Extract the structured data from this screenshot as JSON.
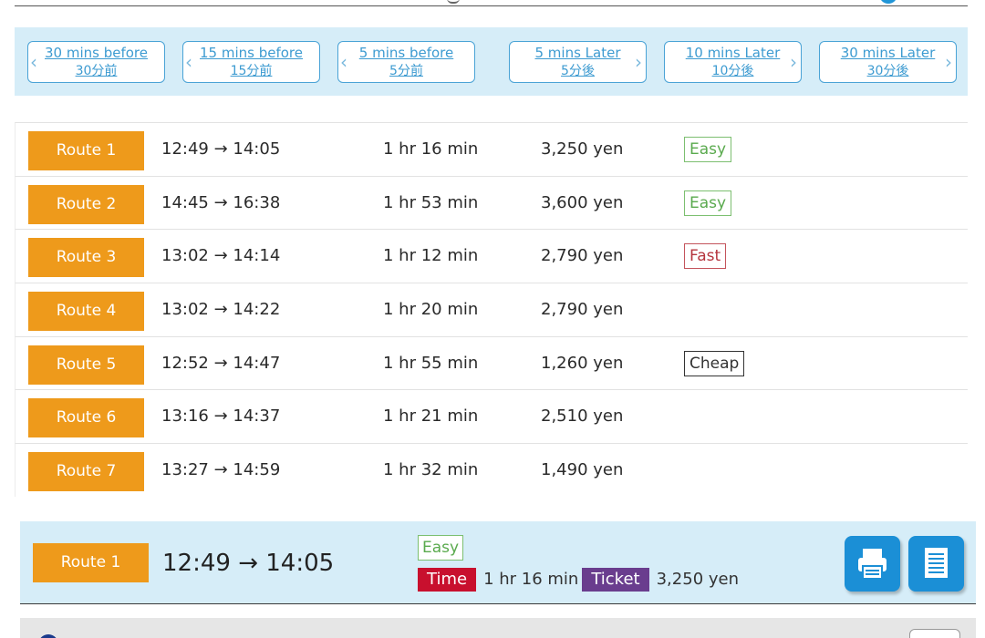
{
  "time_nav": [
    {
      "line1": "30 mins before",
      "line2": "30分前",
      "direction": "left"
    },
    {
      "line1": "15 mins before",
      "line2": "15分前",
      "direction": "left"
    },
    {
      "line1": "5 mins before",
      "line2": "5分前",
      "direction": "left"
    },
    {
      "line1": "5 mins Later",
      "line2": "5分後",
      "direction": "right"
    },
    {
      "line1": "10 mins Later",
      "line2": "10分後",
      "direction": "right"
    },
    {
      "line1": "30 mins Later",
      "line2": "30分後",
      "direction": "right"
    }
  ],
  "routes": [
    {
      "label": "Route 1",
      "time": "12:49 → 14:05",
      "duration": "1 hr 16 min",
      "fare": "3,250 yen",
      "tag": "Easy"
    },
    {
      "label": "Route 2",
      "time": "14:45 → 16:38",
      "duration": "1 hr 53 min",
      "fare": "3,600 yen",
      "tag": "Easy"
    },
    {
      "label": "Route 3",
      "time": "13:02 → 14:14",
      "duration": "1 hr 12 min",
      "fare": "2,790 yen",
      "tag": "Fast"
    },
    {
      "label": "Route 4",
      "time": "13:02 → 14:22",
      "duration": "1 hr 20 min",
      "fare": "2,790 yen",
      "tag": ""
    },
    {
      "label": "Route 5",
      "time": "12:52 → 14:47",
      "duration": "1 hr 55 min",
      "fare": "1,260 yen",
      "tag": "Cheap"
    },
    {
      "label": "Route 6",
      "time": "13:16 → 14:37",
      "duration": "1 hr 21 min",
      "fare": "2,510 yen",
      "tag": ""
    },
    {
      "label": "Route 7",
      "time": "13:27 → 14:59",
      "duration": "1 hr 32 min",
      "fare": "1,490 yen",
      "tag": ""
    }
  ],
  "summary": {
    "label": "Route 1",
    "time": "12:49 → 14:05",
    "tag": "Easy",
    "time_label": "Time",
    "duration": "1 hr 16 min",
    "ticket_label": "Ticket",
    "fare": "3,250 yen"
  },
  "icons": {
    "print": "print-icon",
    "document": "document-icon"
  },
  "colors": {
    "accent_orange": "#ee9a1b",
    "panel_blue": "#d6edf8",
    "link_blue": "#3d9bd1",
    "easy_green": "#5aaa4e",
    "fast_red": "#b5343d",
    "time_pill": "#c8102e",
    "ticket_pill": "#6a3d8e",
    "icon_button": "#1b8fd6"
  }
}
